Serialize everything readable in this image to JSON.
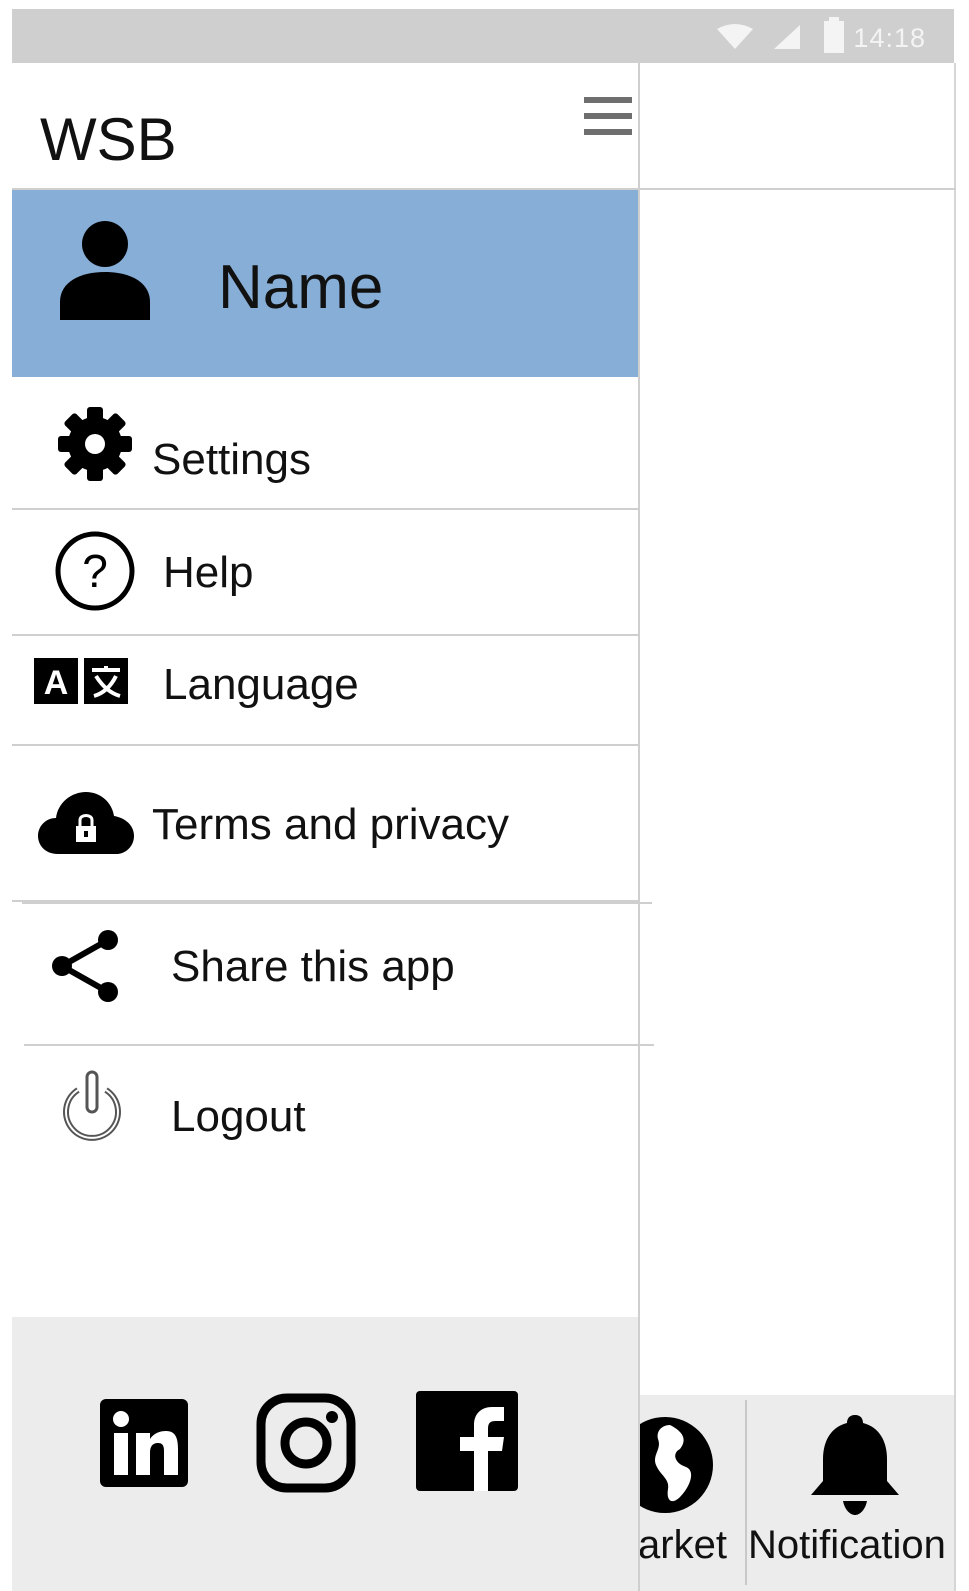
{
  "status_bar": {
    "time": "14:18",
    "icons": [
      "wifi-icon",
      "signal-icon",
      "battery-icon"
    ]
  },
  "drawer": {
    "title": "WSB",
    "menu_icon": "menu-icon",
    "profile": {
      "name": "Name",
      "icon": "person-icon",
      "background": "#86aed6"
    },
    "items": [
      {
        "label": "Settings",
        "icon": "gear-icon"
      },
      {
        "label": "Help",
        "icon": "help-circle-icon"
      },
      {
        "label": "Language",
        "icon": "translate-icon"
      },
      {
        "label": "Terms and privacy",
        "icon": "cloud-lock-icon"
      },
      {
        "label": "Share this app",
        "icon": "share-icon"
      },
      {
        "label": "Logout",
        "icon": "power-icon"
      }
    ],
    "social": [
      "linkedin-icon",
      "instagram-icon",
      "facebook-icon"
    ]
  },
  "bottom_nav": {
    "items": [
      {
        "label": "arket",
        "icon": "globe-icon"
      },
      {
        "label": "Notification",
        "icon": "bell-icon"
      }
    ]
  }
}
